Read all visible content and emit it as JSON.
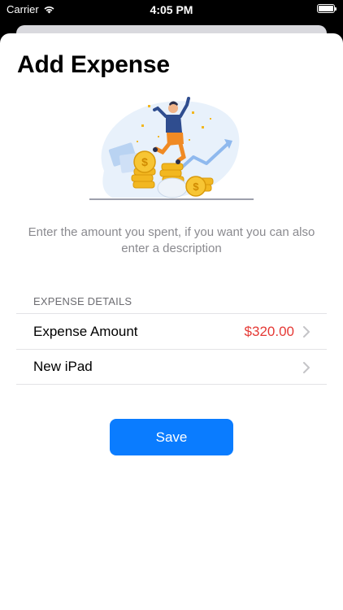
{
  "status_bar": {
    "carrier": "Carrier",
    "time": "4:05 PM"
  },
  "header": {
    "title": "Add Expense"
  },
  "illustration": {
    "icon": "celebration-coins-illustration"
  },
  "subtitle": "Enter the amount you spent, if you want you can also enter a description",
  "section": {
    "header": "EXPENSE DETAILS",
    "rows": [
      {
        "label": "Expense Amount",
        "value": "$320.00"
      },
      {
        "label": "New iPad",
        "value": ""
      }
    ]
  },
  "save_label": "Save",
  "colors": {
    "accent": "#0A7CFF",
    "amount": "#E53935",
    "subtitle": "#8A8A8F"
  }
}
